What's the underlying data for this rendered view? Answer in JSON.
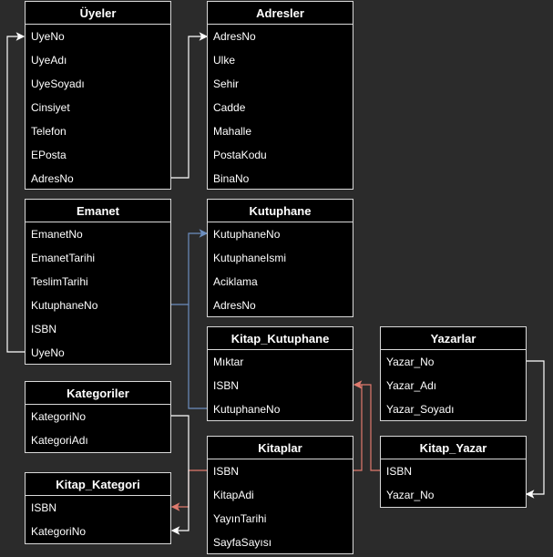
{
  "entities": {
    "uyeler": {
      "title": "Üyeler",
      "fields": [
        "UyeNo",
        "UyeAdı",
        "UyeSoyadı",
        "Cinsiyet",
        "Telefon",
        "EPosta",
        "AdresNo"
      ]
    },
    "adresler": {
      "title": "Adresler",
      "fields": [
        "AdresNo",
        "Ulke",
        "Sehir",
        "Cadde",
        "Mahalle",
        "PostaKodu",
        "BinaNo"
      ]
    },
    "emanet": {
      "title": "Emanet",
      "fields": [
        "EmanetNo",
        "EmanetTarihi",
        "TeslimTarihi",
        "KutuphaneNo",
        "ISBN",
        "UyeNo"
      ]
    },
    "kutuphane": {
      "title": "Kutuphane",
      "fields": [
        "KutuphaneNo",
        "KutuphaneIsmi",
        "Aciklama",
        "AdresNo"
      ]
    },
    "kitap_kutuphane": {
      "title": "Kitap_Kutuphane",
      "fields": [
        "Mıktar",
        "ISBN",
        "KutuphaneNo"
      ]
    },
    "yazarlar": {
      "title": "Yazarlar",
      "fields": [
        "Yazar_No",
        "Yazar_Adı",
        "Yazar_Soyadı"
      ]
    },
    "kategoriler": {
      "title": "Kategoriler",
      "fields": [
        "KategoriNo",
        "KategoriAdı"
      ]
    },
    "kitaplar": {
      "title": "Kitaplar",
      "fields": [
        "ISBN",
        "KitapAdi",
        "YayınTarihi",
        "SayfaSayısı"
      ]
    },
    "kitap_yazar": {
      "title": "Kitap_Yazar",
      "fields": [
        "ISBN",
        "Yazar_No"
      ]
    },
    "kitap_kategori": {
      "title": "Kitap_Kategori",
      "fields": [
        "ISBN",
        "KategoriNo"
      ]
    }
  },
  "relationships": [
    {
      "from": "emanet.UyeNo",
      "to": "uyeler.UyeNo",
      "color": "#ffffff"
    },
    {
      "from": "uyeler.AdresNo",
      "to": "adresler.AdresNo",
      "color": "#ffffff"
    },
    {
      "from": "emanet.KutuphaneNo",
      "to": "kutuphane.KutuphaneNo",
      "color": "#6c8ebf"
    },
    {
      "from": "kitap_kutuphane.KutuphaneNo",
      "to": "kutuphane.KutuphaneNo",
      "color": "#6c8ebf"
    },
    {
      "from": "kitaplar.ISBN",
      "to": "kitap_kutuphane.ISBN",
      "color": "#e07a6e"
    },
    {
      "from": "kitap_yazar.ISBN",
      "to": "kitap_kutuphane.ISBN",
      "color": "#e07a6e"
    },
    {
      "from": "yazarlar.Yazar_No",
      "to": "kitap_yazar.Yazar_No",
      "color": "#ffffff"
    },
    {
      "from": "kitaplar.ISBN",
      "to": "kitap_kategori.ISBN",
      "color": "#e07a6e"
    },
    {
      "from": "kategoriler.KategoriNo",
      "to": "kitap_kategori.KategoriNo",
      "color": "#ffffff"
    }
  ],
  "colors": {
    "background": "#2b2b2b",
    "box": "#000000",
    "border": "#d9d9d9",
    "text": "#ffffff",
    "link_white": "#ffffff",
    "link_blue": "#6c8ebf",
    "link_red": "#e07a6e"
  }
}
